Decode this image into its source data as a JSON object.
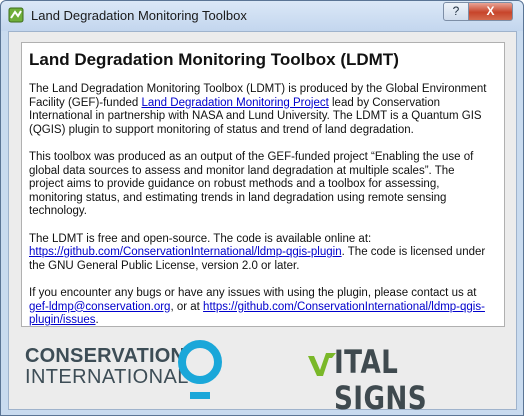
{
  "window": {
    "title": "Land Degradation Monitoring Toolbox",
    "help_glyph": "?",
    "close_glyph": "X"
  },
  "about": {
    "heading": "Land Degradation Monitoring Toolbox (LDMT)",
    "p1": {
      "t1": "The Land Degradation Monitoring Toolbox (LDMT) is produced by the Global Environment Facility (GEF)-funded ",
      "link": "Land Degradation Monitoring Project",
      "t2": " lead by Conservation International in partnership with NASA and Lund University. The LDMT is a Quantum GIS (QGIS) plugin to support monitoring of status and trend of land degradation."
    },
    "p2": "This toolbox was produced as an output of the GEF-funded project “Enabling the use of global data sources to assess and monitor land degradation at multiple scales”. The project aims to provide guidance on robust methods and a toolbox for assessing, monitoring status, and estimating trends in land degradation using remote sensing technology.",
    "p3": {
      "t1": "The LDMT is free and open-source. The code is available online at: ",
      "link": "https://github.com/ConservationInternational/ldmp-qgis-plugin",
      "t2": ". The code is licensed under the GNU General Public License, version 2.0 or later."
    },
    "p4": {
      "t1": "If you encounter any bugs or have any issues with using the plugin, please contact us at ",
      "link1": "gef-ldmp@conservation.org",
      "t2": ", or at ",
      "link2": "https://github.com/ConservationInternational/ldmp-qgis-plugin/issues",
      "t3": "."
    }
  },
  "logos": {
    "ci_line1": "CONSERVATION",
    "ci_line2": "INTERNATIONAL",
    "vs_text": "ITAL SIGNS"
  },
  "colors": {
    "link": "#0000cc",
    "ci_blue": "#1aa7d9",
    "vs_green": "#7ab829",
    "close_red": "#c7442a"
  }
}
